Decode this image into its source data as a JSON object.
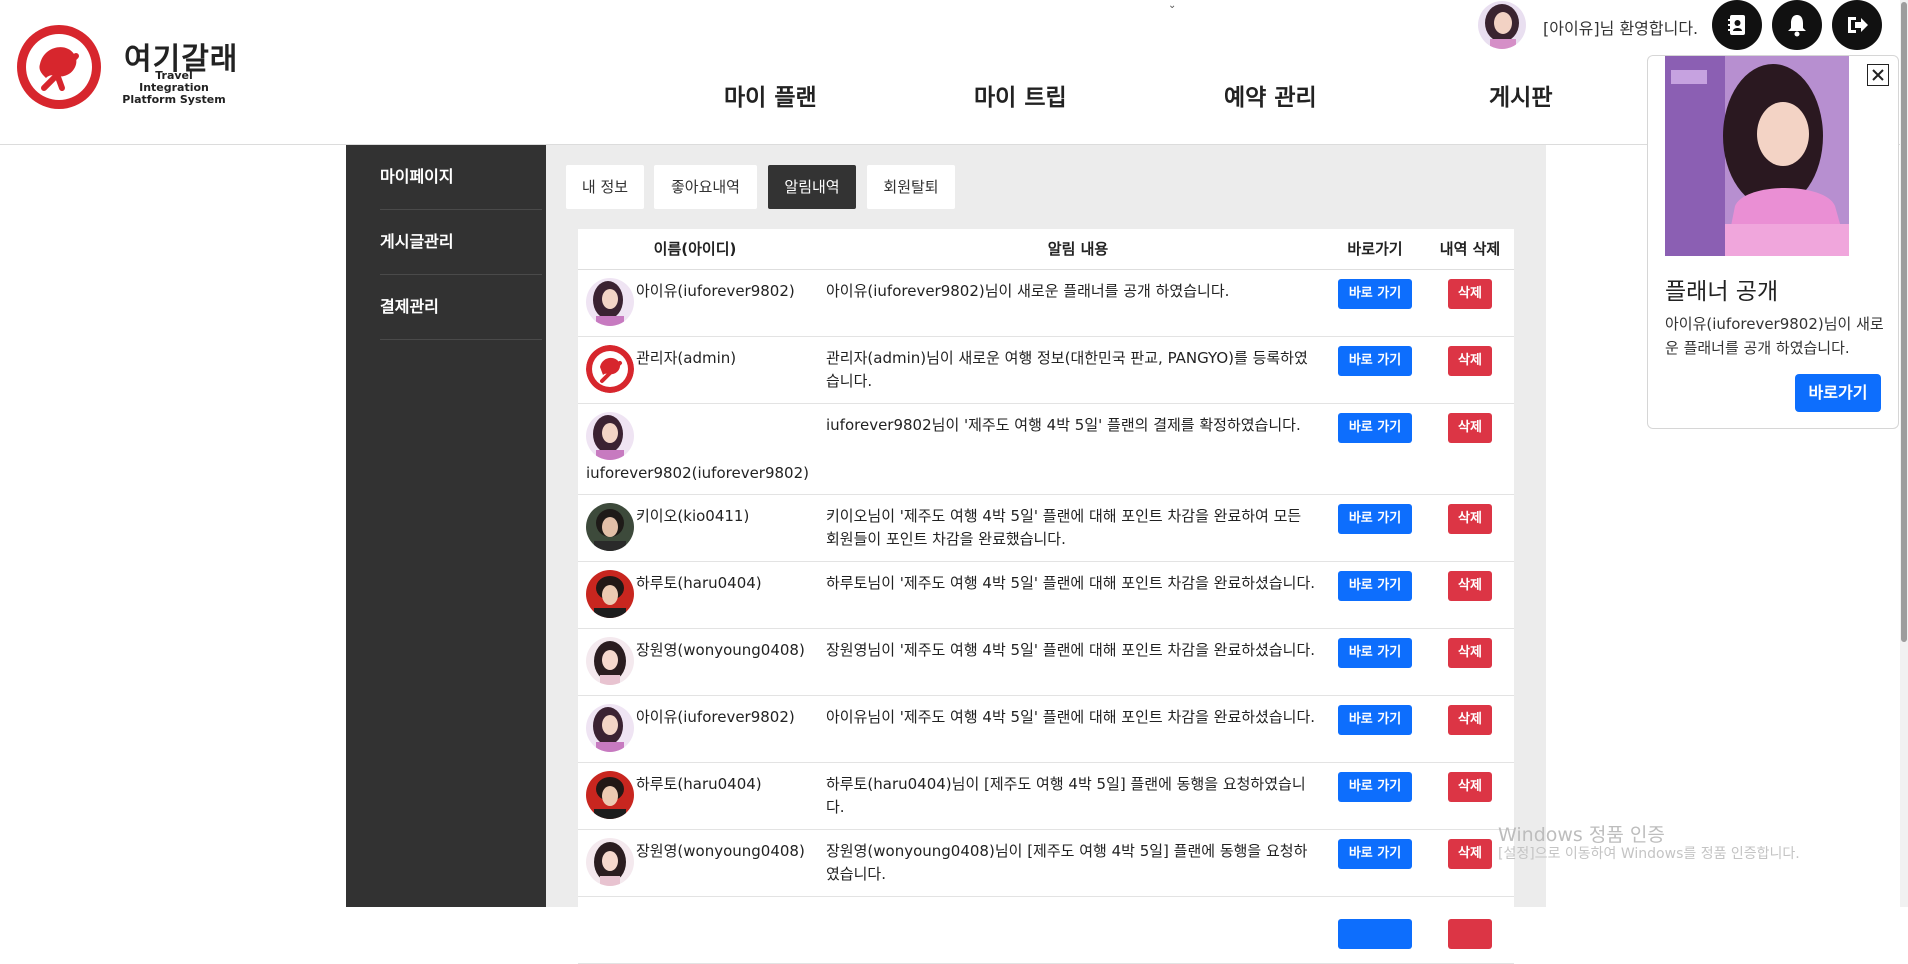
{
  "brand": {
    "title": "여기갈래",
    "subtitle": "Travel Integration Platform System"
  },
  "nav": [
    "마이 플랜",
    "마이 트립",
    "예약 관리",
    "게시판"
  ],
  "user": {
    "welcome": "[아이유]님 환영합니다."
  },
  "header_icons": [
    "contact-book-icon",
    "bell-icon",
    "logout-icon"
  ],
  "sidebar": {
    "items": [
      "마이페이지",
      "게시글관리",
      "결제관리"
    ]
  },
  "tabs": [
    {
      "label": "내 정보",
      "active": false
    },
    {
      "label": "좋아요내역",
      "active": false
    },
    {
      "label": "알림내역",
      "active": true
    },
    {
      "label": "회원탈퇴",
      "active": false
    }
  ],
  "table": {
    "columns": [
      "이름(아이디)",
      "알림 내용",
      "바로가기",
      "내역 삭제"
    ],
    "go_label": "바로 가기",
    "delete_label": "삭제",
    "rows": [
      {
        "name": "아이유(iuforever9802)",
        "message": "아이유(iuforever9802)님이 새로운 플래너를 공개 하였습니다."
      },
      {
        "name": "관리자(admin)",
        "message": "관리자(admin)님이 새로운 여행 정보(대한민국 판교, PANGYO)를 등록하였습니다."
      },
      {
        "name": "iuforever9802(iuforever9802)",
        "message": "iuforever9802님이 '제주도 여행 4박 5일' 플랜의 결제를 확정하였습니다."
      },
      {
        "name": "키이오(kio0411)",
        "message": "키이오님이 '제주도 여행 4박 5일' 플랜에 대해 포인트 차감을 완료하여 모든 회원들이 포인트 차감을 완료했습니다."
      },
      {
        "name": "하루토(haru0404)",
        "message": "하루토님이 '제주도 여행 4박 5일' 플랜에 대해 포인트 차감을 완료하셨습니다."
      },
      {
        "name": "장원영(wonyoung0408)",
        "message": "장원영님이 '제주도 여행 4박 5일' 플랜에 대해 포인트 차감을 완료하셨습니다."
      },
      {
        "name": "아이유(iuforever9802)",
        "message": "아이유님이 '제주도 여행 4박 5일' 플랜에 대해 포인트 차감을 완료하셨습니다."
      },
      {
        "name": "하루토(haru0404)",
        "message": "하루토(haru0404)님이 [제주도 여행 4박 5일] 플랜에 동행을 요청하였습니다."
      },
      {
        "name": "장원영(wonyoung0408)",
        "message": "장원영(wonyoung0408)님이 [제주도 여행 4박 5일] 플랜에 동행을 요청하였습니다."
      }
    ]
  },
  "popup": {
    "title": "플래너 공개",
    "message": "아이유(iuforever9802)님이 새로운 플래너를 공개 하였습니다.",
    "button": "바로가기"
  },
  "watermark": {
    "line1": "Windows 정품 인증",
    "line2": "[설정]으로 이동하여 Windows를 정품 인증합니다."
  },
  "colors": {
    "primary": "#0d6efd",
    "danger": "#dc3545",
    "sidebar": "#323232",
    "brand_red": "#d7262d"
  }
}
